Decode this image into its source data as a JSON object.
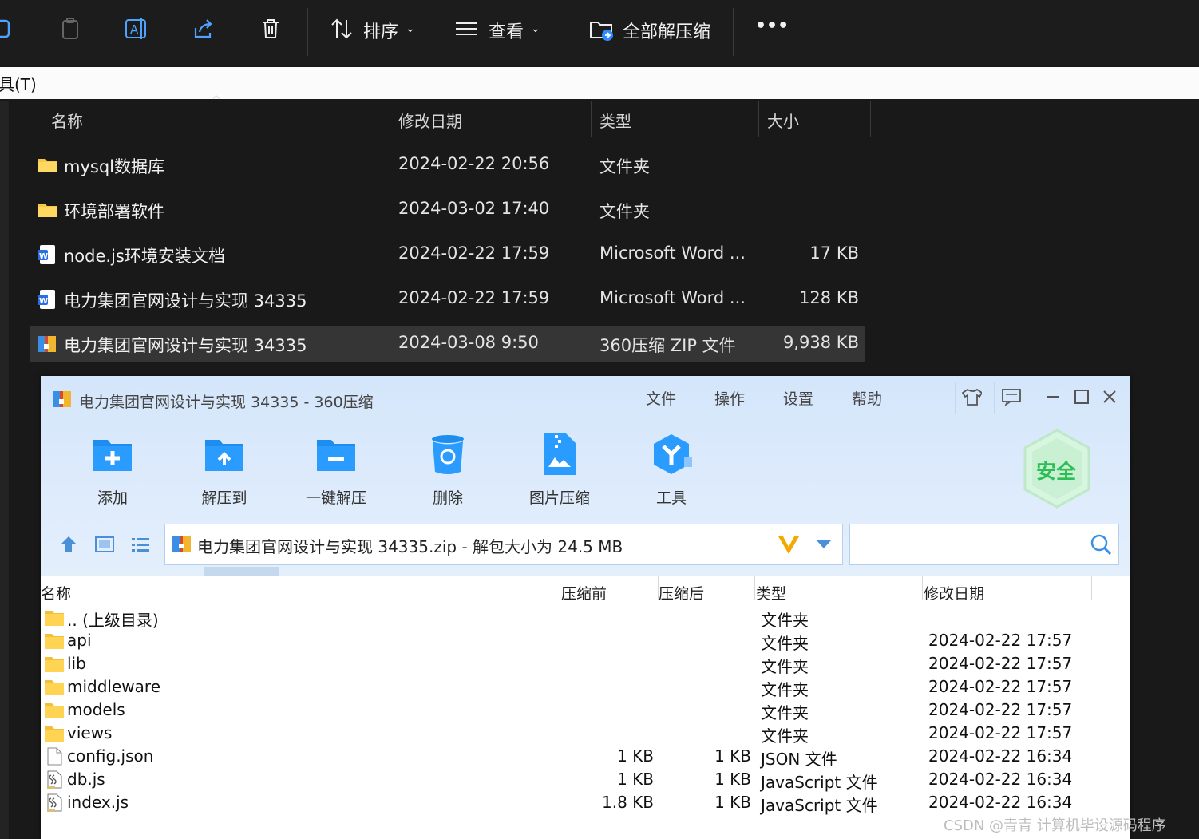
{
  "toolbar": {
    "sort_label": "排序",
    "view_label": "查看",
    "extract_all_label": "全部解压缩",
    "more_label": "•••"
  },
  "address": {
    "text": "具(T)"
  },
  "explorer": {
    "columns": {
      "name": "名称",
      "modified": "修改日期",
      "type": "类型",
      "size": "大小"
    },
    "rows": [
      {
        "name": "mysql数据库",
        "modified": "2024-02-22 20:56",
        "type": "文件夹",
        "size": ""
      },
      {
        "name": "环境部署软件",
        "modified": "2024-03-02 17:40",
        "type": "文件夹",
        "size": ""
      },
      {
        "name": "node.js环境安装文档",
        "modified": "2024-02-22 17:59",
        "type": "Microsoft Word ...",
        "size": "17 KB"
      },
      {
        "name": "电力集团官网设计与实现 34335",
        "modified": "2024-02-22 17:59",
        "type": "Microsoft Word ...",
        "size": "128 KB"
      },
      {
        "name": "电力集团官网设计与实现 34335",
        "modified": "2024-03-08 9:50",
        "type": "360压缩 ZIP 文件",
        "size": "9,938 KB"
      }
    ]
  },
  "zip": {
    "title": "电力集团官网设计与实现 34335 - 360压缩",
    "menu": {
      "file": "文件",
      "operate": "操作",
      "settings": "设置",
      "help": "帮助"
    },
    "buttons": {
      "add": "添加",
      "extract_to": "解压到",
      "one_click": "一键解压",
      "delete": "删除",
      "image_compress": "图片压缩",
      "tools": "工具"
    },
    "badge": "安全",
    "path": "电力集团官网设计与实现 34335.zip - 解包大小为 24.5 MB",
    "columns": {
      "name": "名称",
      "before": "压缩前",
      "after": "压缩后",
      "type": "类型",
      "modified": "修改日期"
    },
    "rows": [
      {
        "name": ".. (上级目录)",
        "before": "",
        "after": "",
        "type": "文件夹",
        "modified": "",
        "icon": "folder-icon"
      },
      {
        "name": "api",
        "before": "",
        "after": "",
        "type": "文件夹",
        "modified": "2024-02-22 17:57",
        "icon": "folder-icon"
      },
      {
        "name": "lib",
        "before": "",
        "after": "",
        "type": "文件夹",
        "modified": "2024-02-22 17:57",
        "icon": "folder-icon"
      },
      {
        "name": "middleware",
        "before": "",
        "after": "",
        "type": "文件夹",
        "modified": "2024-02-22 17:57",
        "icon": "folder-icon"
      },
      {
        "name": "models",
        "before": "",
        "after": "",
        "type": "文件夹",
        "modified": "2024-02-22 17:57",
        "icon": "folder-icon"
      },
      {
        "name": "views",
        "before": "",
        "after": "",
        "type": "文件夹",
        "modified": "2024-02-22 17:57",
        "icon": "folder-icon"
      },
      {
        "name": "config.json",
        "before": "1 KB",
        "after": "1 KB",
        "type": "JSON 文件",
        "modified": "2024-02-22 16:34",
        "icon": "file-icon"
      },
      {
        "name": "db.js",
        "before": "1 KB",
        "after": "1 KB",
        "type": "JavaScript 文件",
        "modified": "2024-02-22 16:34",
        "icon": "script-icon"
      },
      {
        "name": "index.js",
        "before": "1.8 KB",
        "after": "1 KB",
        "type": "JavaScript 文件",
        "modified": "2024-02-22 16:34",
        "icon": "script-icon"
      }
    ]
  },
  "watermark": "CSDN @青青 计算机毕设源码程序"
}
